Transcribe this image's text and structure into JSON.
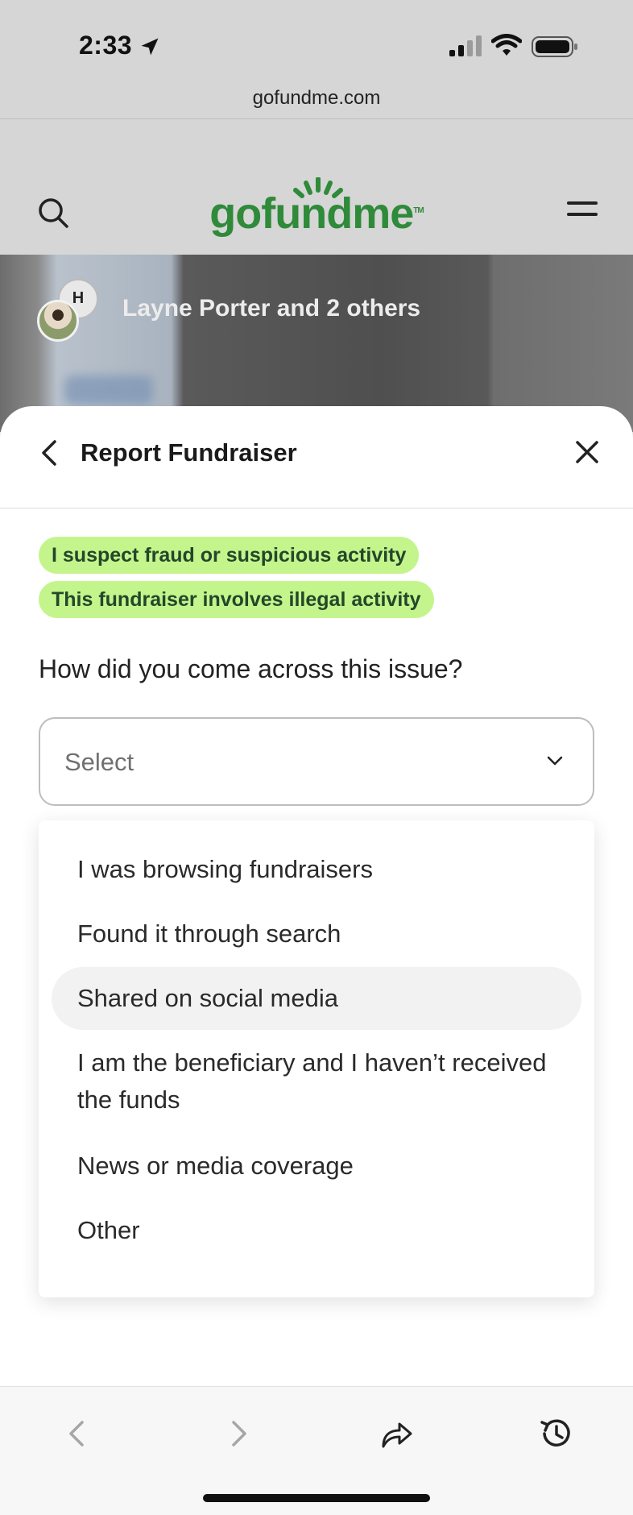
{
  "status_bar": {
    "time": "2:33"
  },
  "browser": {
    "url": "gofundme.com"
  },
  "site_header": {
    "logo_text": "gofundme",
    "logo_tm": "TM"
  },
  "hero": {
    "organizer_text": "Layne Porter and 2 others",
    "avatar_initial": "H"
  },
  "sheet": {
    "title": "Report Fundraiser",
    "tags": [
      "I suspect fraud or suspicious activity",
      "This fundraiser involves illegal activity"
    ],
    "question": "How did you come across this issue?",
    "select": {
      "placeholder": "Select"
    },
    "options": [
      "I was browsing fundraisers",
      "Found it through search",
      "Shared on social media",
      "I am the beneficiary and I haven’t received the funds",
      "News or media coverage",
      "Other"
    ],
    "highlighted_option": "Shared on social media"
  },
  "colors": {
    "brand_green": "#2f8a3a",
    "tag_green": "#c4f58c"
  },
  "icons": [
    "location-arrow-icon",
    "signal-icon",
    "wifi-icon",
    "battery-icon",
    "search-icon",
    "menu-icon",
    "back-icon",
    "close-icon",
    "chevron-down-icon",
    "browser-back-icon",
    "browser-forward-icon",
    "share-icon",
    "history-icon"
  ]
}
